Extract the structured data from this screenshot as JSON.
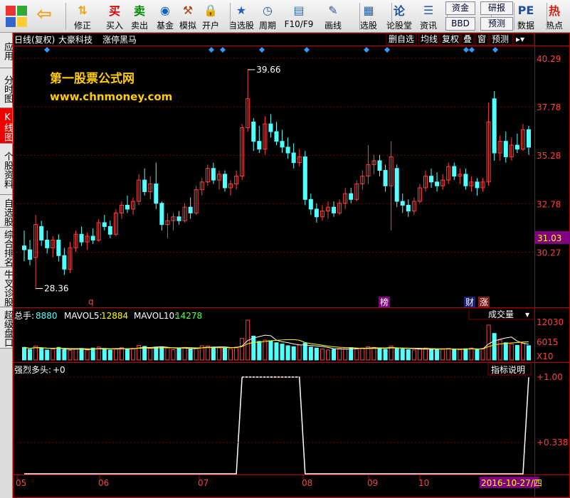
{
  "toolbar": {
    "buttons": [
      {
        "id": "back",
        "label": "",
        "icon": "back-icon"
      },
      {
        "id": "fix",
        "label": "修正",
        "icon": "arrow-updown-icon"
      },
      {
        "id": "buy",
        "label": "买入",
        "icon": "buy-icon"
      },
      {
        "id": "sell",
        "label": "卖出",
        "icon": "sell-icon"
      },
      {
        "id": "fund",
        "label": "基金",
        "icon": "fund-icon"
      },
      {
        "id": "sim",
        "label": "模拟",
        "icon": "hammer-icon"
      },
      {
        "id": "open",
        "label": "开户",
        "icon": "lock-icon"
      },
      {
        "id": "selfsel",
        "label": "自选股",
        "icon": "star-icon"
      },
      {
        "id": "period",
        "label": "周期",
        "icon": "clock-icon"
      },
      {
        "id": "f10",
        "label": "F10/F9",
        "icon": "f10-icon"
      },
      {
        "id": "draw",
        "label": "画线",
        "icon": "pen-icon"
      },
      {
        "id": "pick",
        "label": "选股",
        "icon": "screen-icon"
      },
      {
        "id": "forum",
        "label": "论股堂",
        "icon": "forum-icon"
      },
      {
        "id": "news",
        "label": "资讯",
        "icon": "news-icon"
      },
      {
        "id": "data",
        "label": "数据",
        "icon": "pe-icon"
      },
      {
        "id": "hot",
        "label": "热点",
        "icon": "hot-icon"
      }
    ],
    "minis": {
      "zijin": "资金",
      "bbd": "BBD",
      "yanbao": "研报",
      "yuce": "预测"
    }
  },
  "side_tabs": [
    "应用",
    "分时图",
    "K线图",
    "个股资料",
    "自选股",
    "综合排名",
    "牛叉诊股",
    "超级盘口"
  ],
  "chart_header": {
    "period": "日线(复权)",
    "stock": "大豪科技",
    "formula": "涨停黑马"
  },
  "chart_buttons": [
    "删自选",
    "均线",
    "复权",
    "叠",
    "窗",
    "预测"
  ],
  "watermark": {
    "title": "第一股票公式网",
    "url": "www.chnmoney.com"
  },
  "price_axis": [
    "40.29",
    "37.78",
    "35.28",
    "32.78",
    "30.27"
  ],
  "current_price": "31.03",
  "annotations": {
    "high": "39.66",
    "low": "28.36",
    "q": "q",
    "bang": "榜",
    "cai": "财",
    "zhang": "涨"
  },
  "volume_header": {
    "total_label": "总手:",
    "total": "8880",
    "ma5_label": "MAVOL5:",
    "ma5": "12884",
    "ma10_label": "MAVOL10:",
    "ma10": "14278",
    "selector": "成交量"
  },
  "volume_axis": [
    "12030",
    "6015",
    "X10"
  ],
  "indicator_header": {
    "name": "强烈多头:",
    "value": "+0",
    "explain": "指标说明"
  },
  "indicator_axis": [
    "+1.00",
    "+0.338"
  ],
  "date_axis": [
    "05",
    "06",
    "07",
    "08",
    "09",
    "10"
  ],
  "cursor_date": "2016-10-27/四",
  "colors": {
    "up": "#ff4040",
    "down": "#54ffff",
    "grid": "#800000",
    "axis": "#c00000",
    "accent": "#800080"
  },
  "chart_data": {
    "type": "candlestick",
    "title": "大豪科技",
    "candles": [
      [
        30.6,
        31.4,
        29.8,
        30.4
      ],
      [
        30.4,
        30.9,
        29.6,
        29.9
      ],
      [
        30.0,
        32.2,
        28.4,
        31.7
      ],
      [
        31.6,
        31.9,
        30.6,
        30.9
      ],
      [
        30.9,
        31.4,
        30.2,
        30.5
      ],
      [
        30.5,
        31.1,
        30.0,
        30.9
      ],
      [
        30.9,
        31.2,
        29.8,
        30.1
      ],
      [
        30.1,
        30.5,
        29.1,
        29.4
      ],
      [
        29.4,
        30.8,
        29.2,
        30.5
      ],
      [
        30.5,
        31.4,
        30.3,
        31.2
      ],
      [
        31.2,
        31.6,
        30.6,
        30.8
      ],
      [
        30.8,
        31.3,
        30.4,
        31.1
      ],
      [
        31.1,
        31.5,
        30.7,
        30.9
      ],
      [
        30.9,
        32.0,
        30.8,
        31.8
      ],
      [
        31.8,
        32.2,
        31.4,
        31.6
      ],
      [
        31.6,
        31.9,
        31.0,
        31.2
      ],
      [
        31.2,
        32.5,
        31.1,
        32.3
      ],
      [
        32.3,
        32.9,
        32.0,
        32.7
      ],
      [
        32.7,
        33.2,
        32.3,
        32.5
      ],
      [
        32.5,
        33.1,
        32.2,
        32.9
      ],
      [
        32.9,
        34.3,
        32.7,
        34.0
      ],
      [
        34.0,
        34.6,
        33.2,
        33.4
      ],
      [
        33.4,
        34.2,
        33.0,
        33.8
      ],
      [
        33.8,
        34.9,
        32.5,
        32.8
      ],
      [
        32.8,
        32.9,
        31.4,
        31.7
      ],
      [
        31.7,
        32.3,
        31.0,
        31.9
      ],
      [
        31.9,
        32.3,
        31.4,
        32.1
      ],
      [
        32.1,
        32.4,
        31.7,
        31.9
      ],
      [
        31.9,
        32.8,
        31.8,
        32.6
      ],
      [
        32.6,
        33.1,
        32.0,
        32.3
      ],
      [
        32.3,
        33.7,
        32.2,
        33.5
      ],
      [
        33.5,
        34.1,
        33.2,
        33.9
      ],
      [
        33.9,
        34.8,
        33.7,
        34.6
      ],
      [
        34.6,
        34.9,
        33.8,
        34.0
      ],
      [
        34.0,
        34.5,
        33.5,
        34.3
      ],
      [
        34.3,
        34.5,
        33.4,
        33.6
      ],
      [
        33.6,
        34.0,
        33.2,
        33.8
      ],
      [
        33.8,
        34.5,
        33.5,
        34.2
      ],
      [
        34.2,
        36.9,
        34.0,
        36.7
      ],
      [
        36.7,
        39.7,
        36.5,
        38.2
      ],
      [
        37.0,
        37.2,
        35.5,
        36.0
      ],
      [
        36.0,
        36.8,
        35.4,
        35.6
      ],
      [
        35.6,
        37.3,
        35.3,
        36.9
      ],
      [
        36.9,
        37.4,
        36.2,
        36.5
      ],
      [
        36.5,
        37.0,
        35.8,
        36.0
      ],
      [
        36.0,
        36.6,
        35.4,
        35.7
      ],
      [
        35.7,
        36.2,
        35.1,
        35.4
      ],
      [
        35.4,
        35.9,
        34.6,
        34.9
      ],
      [
        34.9,
        35.6,
        34.7,
        35.2
      ],
      [
        35.2,
        35.5,
        32.7,
        33.0
      ],
      [
        33.0,
        33.3,
        32.2,
        32.5
      ],
      [
        32.5,
        32.8,
        31.8,
        32.1
      ],
      [
        32.1,
        32.7,
        31.9,
        32.4
      ],
      [
        32.4,
        32.9,
        32.0,
        32.6
      ],
      [
        32.6,
        32.9,
        32.1,
        32.3
      ],
      [
        32.3,
        33.0,
        32.2,
        32.8
      ],
      [
        32.8,
        33.6,
        32.5,
        33.3
      ],
      [
        33.3,
        33.6,
        32.8,
        33.0
      ],
      [
        33.0,
        34.0,
        32.9,
        33.8
      ],
      [
        33.8,
        34.5,
        33.5,
        34.2
      ],
      [
        34.2,
        35.8,
        33.8,
        34.8
      ],
      [
        34.8,
        35.3,
        34.3,
        35.0
      ],
      [
        35.0,
        35.3,
        34.2,
        34.5
      ],
      [
        34.5,
        34.8,
        33.4,
        33.7
      ],
      [
        33.7,
        36.0,
        31.4,
        35.2
      ],
      [
        34.6,
        34.8,
        32.6,
        32.9
      ],
      [
        32.9,
        33.3,
        32.3,
        32.7
      ],
      [
        32.7,
        33.0,
        32.1,
        32.4
      ],
      [
        32.4,
        33.1,
        32.2,
        32.9
      ],
      [
        32.9,
        33.8,
        32.8,
        33.6
      ],
      [
        33.6,
        34.5,
        33.4,
        34.2
      ],
      [
        34.2,
        34.6,
        33.6,
        33.9
      ],
      [
        33.9,
        34.4,
        33.4,
        33.7
      ],
      [
        33.7,
        34.3,
        33.5,
        34.0
      ],
      [
        34.0,
        34.9,
        33.8,
        34.7
      ],
      [
        34.7,
        34.9,
        34.0,
        34.2
      ],
      [
        34.2,
        34.6,
        33.8,
        34.3
      ],
      [
        34.3,
        34.6,
        33.5,
        33.7
      ],
      [
        33.7,
        34.2,
        33.4,
        33.9
      ],
      [
        33.9,
        34.1,
        33.2,
        33.6
      ],
      [
        33.6,
        34.1,
        33.4,
        33.9
      ],
      [
        33.9,
        38.0,
        33.7,
        37.0
      ],
      [
        38.2,
        38.6,
        35.0,
        35.4
      ],
      [
        35.4,
        36.3,
        35.0,
        36.0
      ],
      [
        36.0,
        36.5,
        34.9,
        35.2
      ],
      [
        35.2,
        36.2,
        35.0,
        35.8
      ],
      [
        35.8,
        36.4,
        35.4,
        35.6
      ],
      [
        35.6,
        36.9,
        35.5,
        36.6
      ],
      [
        36.6,
        36.8,
        35.3,
        35.7
      ]
    ],
    "volumes": [
      3.8,
      3.2,
      4.2,
      3.6,
      3.0,
      3.3,
      3.8,
      3.1,
      2.9,
      3.3,
      3.5,
      3.0,
      3.6,
      3.9,
      3.4,
      3.0,
      3.3,
      3.7,
      3.2,
      3.5,
      4.4,
      4.1,
      3.5,
      3.9,
      4.0,
      3.6,
      3.1,
      3.4,
      3.8,
      3.3,
      3.6,
      4.3,
      4.2,
      3.9,
      3.7,
      3.6,
      3.4,
      3.9,
      6.5,
      12.0,
      7.2,
      5.6,
      6.0,
      5.8,
      5.2,
      4.8,
      4.3,
      4.0,
      4.5,
      5.1,
      3.9,
      3.6,
      3.3,
      3.0,
      3.2,
      3.5,
      3.4,
      3.7,
      3.3,
      3.6,
      4.0,
      3.8,
      3.5,
      3.2,
      4.2,
      3.6,
      3.3,
      3.1,
      3.0,
      3.3,
      3.6,
      3.4,
      3.1,
      3.2,
      3.5,
      3.3,
      3.1,
      3.4,
      3.6,
      3.2,
      3.5,
      10.5,
      8.0,
      6.0,
      5.2,
      4.8,
      4.4,
      5.0,
      4.3
    ],
    "ylim": [
      27.5,
      40.8
    ],
    "indicator": [
      0,
      0,
      0,
      0,
      0,
      0,
      0,
      0,
      0,
      0,
      0,
      0,
      0,
      0,
      0,
      0,
      0,
      0,
      0,
      0,
      0,
      0,
      0,
      0,
      0,
      0,
      0,
      0,
      0,
      0,
      0,
      0,
      0,
      0,
      0,
      0,
      0,
      0,
      1,
      1,
      1,
      1,
      1,
      1,
      1,
      1,
      1,
      1,
      1,
      0,
      0,
      0,
      0,
      0,
      0,
      0,
      0,
      0,
      0,
      0,
      0,
      0,
      0,
      0,
      0,
      0,
      0,
      0,
      0,
      0,
      0,
      0,
      0,
      0,
      0,
      0,
      0,
      0,
      0,
      0,
      0,
      0,
      0,
      0,
      0,
      0,
      0,
      0,
      1
    ]
  }
}
